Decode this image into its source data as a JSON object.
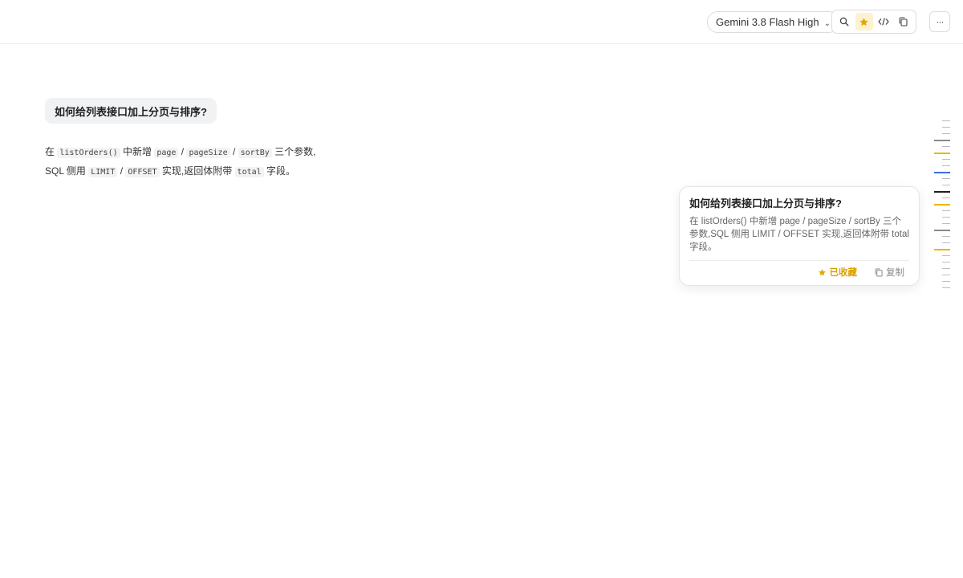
{
  "header": {
    "model_label": "Gemini 3.8 Flash High",
    "model_chevron": "⌄",
    "more_label": "···"
  },
  "conversation": {
    "question": "如何给列表接口加上分页与排序?",
    "answer": {
      "line1_prefix": "在",
      "line1_code1": "listOrders()",
      "line1_mid1": "中新增",
      "line1_code2": "page",
      "sep1": "/",
      "line1_code3": "pageSize",
      "sep2": "/",
      "line1_code4": "sortBy",
      "line1_suffix": "三个参数,",
      "line2_prefix": "SQL 侧用",
      "line2_code1": "LIMIT",
      "sep3": "/",
      "line2_code2": "OFFSET",
      "line2_mid": "实现,返回体附带",
      "line2_code3": "total",
      "line2_suffix": "字段。"
    }
  },
  "popup": {
    "title": "如何给列表接口加上分页与排序?",
    "body": "在 listOrders() 中新增 page / pageSize / sortBy 三个参数,SQL 侧用 LIMIT / OFFSET 实现,返回体附带 total 字段。",
    "favorited_label": "已收藏",
    "copy_label": "复制"
  },
  "minimap": {
    "markers": [
      {
        "color": "#bdbdbd",
        "type": "short"
      },
      {
        "color": "#bdbdbd",
        "type": "short"
      },
      {
        "color": "#bdbdbd",
        "type": "short"
      },
      {
        "color": "#8a8a8a",
        "type": "long"
      },
      {
        "color": "#bdbdbd",
        "type": "short"
      },
      {
        "color": "#f0b400",
        "type": "long"
      },
      {
        "color": "#bdbdbd",
        "type": "short"
      },
      {
        "color": "#bdbdbd",
        "type": "short"
      },
      {
        "color": "#3d6fe0",
        "type": "long"
      },
      {
        "color": "#bdbdbd",
        "type": "short"
      },
      {
        "color": "#bdbdbd",
        "type": "short"
      },
      {
        "color": "#1f1f1f",
        "type": "long"
      },
      {
        "color": "#bdbdbd",
        "type": "short"
      },
      {
        "color": "#f0b400",
        "type": "long"
      },
      {
        "color": "#bdbdbd",
        "type": "short"
      },
      {
        "color": "#bdbdbd",
        "type": "short"
      },
      {
        "color": "#bdbdbd",
        "type": "short"
      },
      {
        "color": "#8a8a8a",
        "type": "long"
      },
      {
        "color": "#bdbdbd",
        "type": "short"
      },
      {
        "color": "#bdbdbd",
        "type": "short"
      },
      {
        "color": "#f0b400",
        "type": "long"
      },
      {
        "color": "#bdbdbd",
        "type": "short"
      },
      {
        "color": "#bdbdbd",
        "type": "short"
      },
      {
        "color": "#bdbdbd",
        "type": "short"
      },
      {
        "color": "#bdbdbd",
        "type": "short"
      },
      {
        "color": "#bdbdbd",
        "type": "short"
      },
      {
        "color": "#bdbdbd",
        "type": "short"
      }
    ]
  },
  "colors": {
    "accent_yellow": "#d9a100",
    "active_bg": "#fdf1cf",
    "accent_blue": "#3d6fe0"
  },
  "icons": {
    "search": "search-icon",
    "star": "star-icon",
    "code": "code-icon",
    "copy": "copy-icon",
    "more": "more-icon"
  }
}
